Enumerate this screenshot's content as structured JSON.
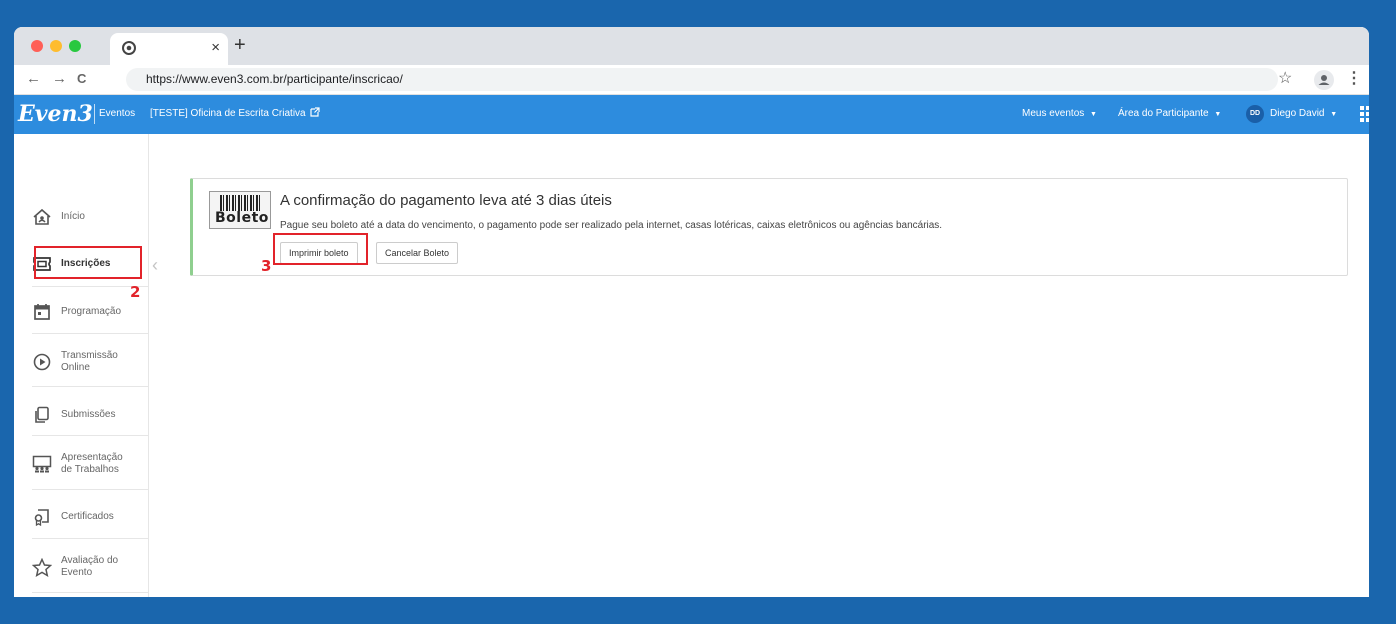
{
  "colors": {
    "page_bg": "#1a66ad",
    "site_header": "#2d8cde",
    "alert_border": "#8fcf8f",
    "annotation": "#e2232a"
  },
  "browser": {
    "tab_close": "×",
    "new_tab": "+",
    "back_glyph": "←",
    "forward_glyph": "→",
    "reload_glyph": "C",
    "url": "https://www.even3.com.br/participante/inscricao/",
    "star_glyph": "☆",
    "menu_glyph": "⋮"
  },
  "header": {
    "logo": "Even3",
    "eventos": "Eventos",
    "event_name": "[TESTE] Oficina de Escrita Criativa",
    "meus_eventos": "Meus eventos",
    "area": "Área do Participante",
    "avatar_initials": "DD",
    "user": "Diego David"
  },
  "sidebar": {
    "items": [
      {
        "label": "Início",
        "icon": "home-icon"
      },
      {
        "label": "Inscrições",
        "icon": "ticket-icon"
      },
      {
        "label": "Programação",
        "icon": "calendar-icon"
      },
      {
        "label": "Transmissão Online",
        "icon": "play-circle-icon"
      },
      {
        "label": "Submissões",
        "icon": "copy-icon"
      },
      {
        "label": "Apresentação de Trabalhos",
        "icon": "presentation-icon"
      },
      {
        "label": "Certificados",
        "icon": "certificate-icon"
      },
      {
        "label": "Avaliação do Evento",
        "icon": "star-icon"
      }
    ]
  },
  "alert": {
    "logo_text": "Boleto",
    "title": "A confirmação do pagamento leva até 3 dias úteis",
    "message": "Pague seu boleto até a data do vencimento, o pagamento pode ser realizado pela internet, casas lotéricas, caixas eletrônicos ou agências bancárias.",
    "print_button": "Imprimir boleto",
    "cancel_button": "Cancelar Boleto"
  },
  "annotations": {
    "step_2": "2",
    "step_3": "3"
  }
}
